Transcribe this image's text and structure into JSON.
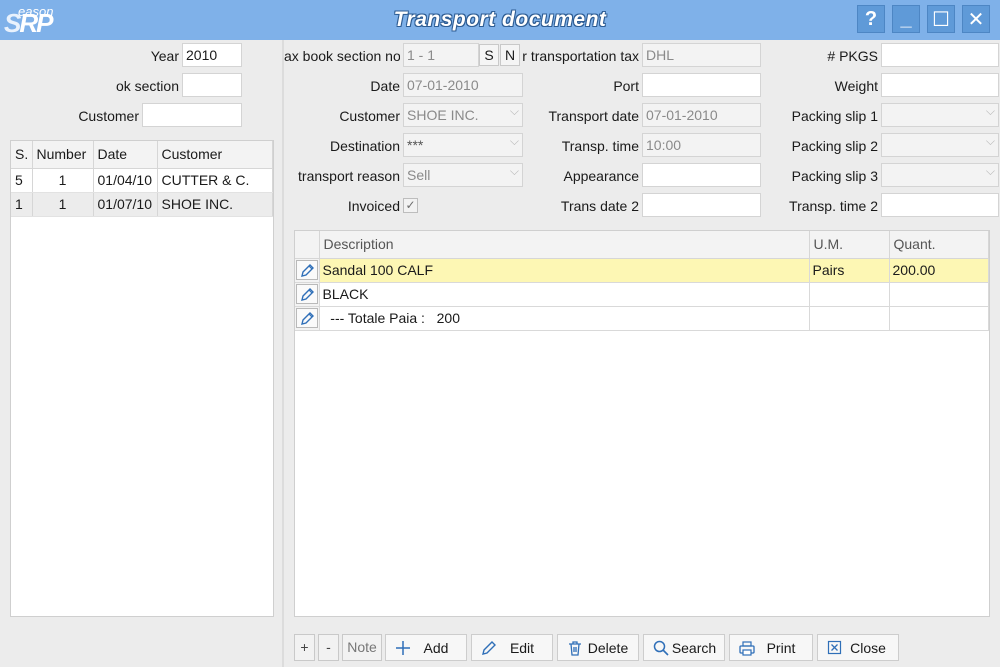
{
  "window": {
    "logo_small": "eason",
    "logo_s": "S",
    "logo_rp": "RP",
    "title": "Transport document",
    "help_glyph": "?",
    "minimize_glyph": "_",
    "maximize_glyph": "☐",
    "close_glyph": "✕"
  },
  "filters": {
    "year_label": "Year",
    "year_value": "2010",
    "section_label": "ok section",
    "section_value": "",
    "customer_label": "Customer",
    "customer_value": ""
  },
  "doc_list": {
    "columns": [
      "S.",
      "Number",
      "Date",
      "Customer"
    ],
    "rows": [
      [
        "5",
        "1",
        "01/04/10",
        "CUTTER & C."
      ],
      [
        "1",
        "1",
        "01/07/10",
        "SHOE INC."
      ]
    ]
  },
  "form": {
    "tax_book_label": "ax book section no.",
    "tax_book_value": "1 - 1",
    "s_button": "S",
    "n_button": "N",
    "transport_tax_label": "r transportation tax",
    "transport_tax_value": "DHL",
    "pkgs_label": "# PKGS",
    "pkgs_value": "",
    "date_label": "Date",
    "date_value": "07-01-2010",
    "port_label": "Port",
    "port_value": "",
    "weight_label": "Weight",
    "weight_value": "",
    "customer_label": "Customer",
    "customer_value": "SHOE INC.",
    "transport_date_label": "Transport date",
    "transport_date_value": "07-01-2010",
    "packing_slip1_label": "Packing slip 1",
    "packing_slip1_value": "",
    "destination_label": "Destination",
    "destination_value": "***",
    "transp_time_label": "Transp. time",
    "transp_time_value": "10:00",
    "packing_slip2_label": "Packing slip 2",
    "packing_slip2_value": "",
    "reason_label": "transport reason",
    "reason_value": "Sell",
    "appearance_label": "Appearance",
    "appearance_value": "",
    "packing_slip3_label": "Packing slip 3",
    "packing_slip3_value": "",
    "invoiced_label": "Invoiced",
    "invoiced_checked": true,
    "invoiced_glyph": "✓",
    "trans_date2_label": "Trans date 2",
    "trans_date2_value": "",
    "transp_time2_label": "Transp. time 2",
    "transp_time2_value": ""
  },
  "items": {
    "columns": [
      "",
      "Description",
      "U.M.",
      "Quant."
    ],
    "rows": [
      {
        "description": "Sandal 100 CALF",
        "um": "Pairs",
        "quant": "200.00"
      },
      {
        "description": "BLACK",
        "um": "",
        "quant": ""
      },
      {
        "description": "  --- Totale Paia :   200",
        "um": "",
        "quant": ""
      }
    ]
  },
  "toolbar": {
    "plus": "+",
    "minus": "-",
    "note": "Note",
    "add": "Add",
    "edit": "Edit",
    "delete": "Delete",
    "search": "Search",
    "print": "Print",
    "close": "Close"
  },
  "colors": {
    "titlebar": "#7fb1e9",
    "highlight_row": "#fdf7b4",
    "icon_blue": "#2f6fb8"
  },
  "icons": [
    "pencil-icon",
    "plus-icon",
    "trash-icon",
    "search-icon",
    "printer-icon",
    "close-box-icon"
  ]
}
